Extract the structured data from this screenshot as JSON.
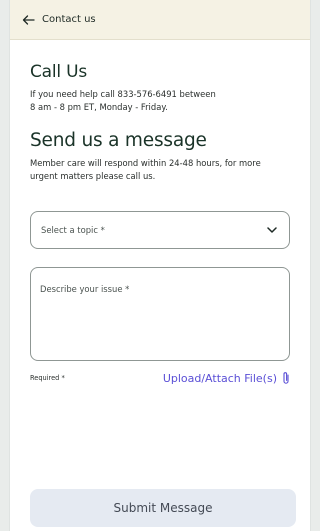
{
  "header": {
    "title": "Contact us",
    "back_icon": "arrow-left-icon"
  },
  "call_section": {
    "heading": "Call Us",
    "line1": "If you need help call 833-576-6491 between",
    "line2": "8 am - 8 pm ET, Monday - Friday."
  },
  "message_section": {
    "heading": "Send us a message",
    "line1": "Member care will respond within 24-48 hours, for more",
    "line2": "urgent matters please call us."
  },
  "form": {
    "topic_placeholder": "Select a topic *",
    "topic_icon": "chevron-down-icon",
    "issue_placeholder": "Describe your issue *",
    "required_note": "Required *",
    "upload_label": "Upload/Attach File(s)",
    "upload_icon": "paperclip-icon",
    "submit_label": "Submit Message"
  },
  "colors": {
    "header_bg": "#f5f2e4",
    "link": "#5a4fd6",
    "submit_bg": "#e5eaf2",
    "border": "#8f9794"
  }
}
